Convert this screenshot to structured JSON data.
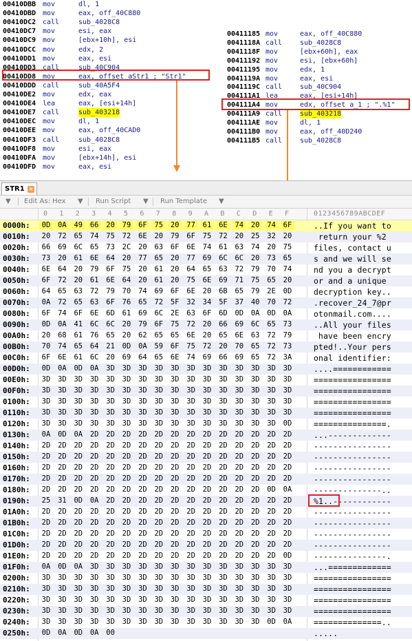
{
  "left_disasm": [
    {
      "addr": "00410DBB",
      "mn": "mov",
      "op": "dl, 1"
    },
    {
      "addr": "00410DBD",
      "mn": "mov",
      "op": "eax, off_40C880"
    },
    {
      "addr": "00410DC2",
      "mn": "call",
      "op": "sub_4028C8"
    },
    {
      "addr": "00410DC7",
      "mn": "mov",
      "op": "esi, eax"
    },
    {
      "addr": "00410DC9",
      "mn": "mov",
      "op": "[ebx+10h], esi"
    },
    {
      "addr": "00410DCC",
      "mn": "mov",
      "op": "edx, 2"
    },
    {
      "addr": "00410DD1",
      "mn": "mov",
      "op": "eax, esi"
    },
    {
      "addr": "00410DD3",
      "mn": "call",
      "op": "sub_40C904"
    },
    {
      "addr": "00410DD8",
      "mn": "mov",
      "op": "eax, offset aStr1 ; \"Str1\""
    },
    {
      "addr": "00410DDD",
      "mn": "call",
      "op": "sub_40A5F4"
    },
    {
      "addr": "00410DE2",
      "mn": "mov",
      "op": "edx, eax"
    },
    {
      "addr": "00410DE4",
      "mn": "lea",
      "op": "eax, [esi+14h]"
    },
    {
      "addr": "00410DE7",
      "mn": "call",
      "op": "sub_403218"
    },
    {
      "addr": "00410DEC",
      "mn": "mov",
      "op": "dl, 1"
    },
    {
      "addr": "00410DEE",
      "mn": "mov",
      "op": "eax, off_40CAD0"
    },
    {
      "addr": "00410DF3",
      "mn": "call",
      "op": "sub_4028C8"
    },
    {
      "addr": "00410DF8",
      "mn": "mov",
      "op": "esi, eax"
    },
    {
      "addr": "00410DFA",
      "mn": "mov",
      "op": "[ebx+14h], esi"
    },
    {
      "addr": "00410DFD",
      "mn": "mov",
      "op": "eax, esi"
    }
  ],
  "right_disasm": [
    {
      "addr": "00411185",
      "mn": "mov",
      "op": "eax, off_40C880"
    },
    {
      "addr": "0041118A",
      "mn": "call",
      "op": "sub_4028C8"
    },
    {
      "addr": "0041118F",
      "mn": "mov",
      "op": "[ebx+60h], eax"
    },
    {
      "addr": "00411192",
      "mn": "mov",
      "op": "esi, [ebx+60h]"
    },
    {
      "addr": "00411195",
      "mn": "mov",
      "op": "edx, 1"
    },
    {
      "addr": "0041119A",
      "mn": "mov",
      "op": "eax, esi"
    },
    {
      "addr": "0041119C",
      "mn": "call",
      "op": "sub_40C904"
    },
    {
      "addr": "004111A1",
      "mn": "lea",
      "op": "eax, [esi+14h]"
    },
    {
      "addr": "004111A4",
      "mn": "mov",
      "op": "edx, offset a_1 ; \".%1\""
    },
    {
      "addr": "004111A9",
      "mn": "call",
      "op": "sub_403218"
    },
    {
      "addr": "004111AE",
      "mn": "mov",
      "op": "dl, 1"
    },
    {
      "addr": "004111B0",
      "mn": "mov",
      "op": "eax, off_40D240"
    },
    {
      "addr": "004111B5",
      "mn": "call",
      "op": "sub_4028C8"
    }
  ],
  "editor": {
    "tab_label": "STR1",
    "tab_close": "×",
    "toolbar": {
      "menu_icon": "▼",
      "edit_as": "Edit As: Hex",
      "run_script": "Run Script",
      "run_template": "Run Template",
      "dropdown": "▼"
    },
    "column_headers": [
      "0",
      "1",
      "2",
      "3",
      "4",
      "5",
      "6",
      "7",
      "8",
      "9",
      "A",
      "B",
      "C",
      "D",
      "E",
      "F"
    ],
    "ascii_header": "0123456789ABCDEF",
    "rows": [
      {
        "offset": "0000h:",
        "bytes": [
          "0D",
          "0A",
          "49",
          "66",
          "20",
          "79",
          "6F",
          "75",
          "20",
          "77",
          "61",
          "6E",
          "74",
          "20",
          "74",
          "6F"
        ],
        "text": "..If you want to"
      },
      {
        "offset": "0010h:",
        "bytes": [
          "20",
          "72",
          "65",
          "74",
          "75",
          "72",
          "6E",
          "20",
          "79",
          "6F",
          "75",
          "72",
          "20",
          "25",
          "32",
          "20"
        ],
        "text": " return your %2 "
      },
      {
        "offset": "0020h:",
        "bytes": [
          "66",
          "69",
          "6C",
          "65",
          "73",
          "2C",
          "20",
          "63",
          "6F",
          "6E",
          "74",
          "61",
          "63",
          "74",
          "20",
          "75"
        ],
        "text": "files, contact u"
      },
      {
        "offset": "0030h:",
        "bytes": [
          "73",
          "20",
          "61",
          "6E",
          "64",
          "20",
          "77",
          "65",
          "20",
          "77",
          "69",
          "6C",
          "6C",
          "20",
          "73",
          "65"
        ],
        "text": "s and we will se"
      },
      {
        "offset": "0040h:",
        "bytes": [
          "6E",
          "64",
          "20",
          "79",
          "6F",
          "75",
          "20",
          "61",
          "20",
          "64",
          "65",
          "63",
          "72",
          "79",
          "70",
          "74"
        ],
        "text": "nd you a decrypt"
      },
      {
        "offset": "0050h:",
        "bytes": [
          "6F",
          "72",
          "20",
          "61",
          "6E",
          "64",
          "20",
          "61",
          "20",
          "75",
          "6E",
          "69",
          "71",
          "75",
          "65",
          "20"
        ],
        "text": "or and a unique "
      },
      {
        "offset": "0060h:",
        "bytes": [
          "64",
          "65",
          "63",
          "72",
          "79",
          "70",
          "74",
          "69",
          "6F",
          "6E",
          "20",
          "6B",
          "65",
          "79",
          "2E",
          "0D"
        ],
        "text": "decryption key.."
      },
      {
        "offset": "0070h:",
        "bytes": [
          "0A",
          "72",
          "65",
          "63",
          "6F",
          "76",
          "65",
          "72",
          "5F",
          "32",
          "34",
          "5F",
          "37",
          "40",
          "70",
          "72"
        ],
        "text": ".recover_24_7@pr"
      },
      {
        "offset": "0080h:",
        "bytes": [
          "6F",
          "74",
          "6F",
          "6E",
          "6D",
          "61",
          "69",
          "6C",
          "2E",
          "63",
          "6F",
          "6D",
          "0D",
          "0A",
          "0D",
          "0A"
        ],
        "text": "otonmail.com...."
      },
      {
        "offset": "0090h:",
        "bytes": [
          "0D",
          "0A",
          "41",
          "6C",
          "6C",
          "20",
          "79",
          "6F",
          "75",
          "72",
          "20",
          "66",
          "69",
          "6C",
          "65",
          "73"
        ],
        "text": "..All your files"
      },
      {
        "offset": "00A0h:",
        "bytes": [
          "20",
          "68",
          "61",
          "76",
          "65",
          "20",
          "62",
          "65",
          "65",
          "6E",
          "20",
          "65",
          "6E",
          "63",
          "72",
          "79"
        ],
        "text": " have been encry"
      },
      {
        "offset": "00B0h:",
        "bytes": [
          "70",
          "74",
          "65",
          "64",
          "21",
          "0D",
          "0A",
          "59",
          "6F",
          "75",
          "72",
          "20",
          "70",
          "65",
          "72",
          "73"
        ],
        "text": "pted!..Your pers"
      },
      {
        "offset": "00C0h:",
        "bytes": [
          "6F",
          "6E",
          "61",
          "6C",
          "20",
          "69",
          "64",
          "65",
          "6E",
          "74",
          "69",
          "66",
          "69",
          "65",
          "72",
          "3A"
        ],
        "text": "onal identifier:"
      },
      {
        "offset": "00D0h:",
        "bytes": [
          "0D",
          "0A",
          "0D",
          "0A",
          "3D",
          "3D",
          "3D",
          "3D",
          "3D",
          "3D",
          "3D",
          "3D",
          "3D",
          "3D",
          "3D",
          "3D"
        ],
        "text": "....============"
      },
      {
        "offset": "00E0h:",
        "bytes": [
          "3D",
          "3D",
          "3D",
          "3D",
          "3D",
          "3D",
          "3D",
          "3D",
          "3D",
          "3D",
          "3D",
          "3D",
          "3D",
          "3D",
          "3D",
          "3D"
        ],
        "text": "================"
      },
      {
        "offset": "00F0h:",
        "bytes": [
          "3D",
          "3D",
          "3D",
          "3D",
          "3D",
          "3D",
          "3D",
          "3D",
          "3D",
          "3D",
          "3D",
          "3D",
          "3D",
          "3D",
          "3D",
          "3D"
        ],
        "text": "================"
      },
      {
        "offset": "0100h:",
        "bytes": [
          "3D",
          "3D",
          "3D",
          "3D",
          "3D",
          "3D",
          "3D",
          "3D",
          "3D",
          "3D",
          "3D",
          "3D",
          "3D",
          "3D",
          "3D",
          "3D"
        ],
        "text": "================"
      },
      {
        "offset": "0110h:",
        "bytes": [
          "3D",
          "3D",
          "3D",
          "3D",
          "3D",
          "3D",
          "3D",
          "3D",
          "3D",
          "3D",
          "3D",
          "3D",
          "3D",
          "3D",
          "3D",
          "3D"
        ],
        "text": "================"
      },
      {
        "offset": "0120h:",
        "bytes": [
          "3D",
          "3D",
          "3D",
          "3D",
          "3D",
          "3D",
          "3D",
          "3D",
          "3D",
          "3D",
          "3D",
          "3D",
          "3D",
          "3D",
          "3D",
          "0D"
        ],
        "text": "===============."
      },
      {
        "offset": "0130h:",
        "bytes": [
          "0A",
          "0D",
          "0A",
          "2D",
          "2D",
          "2D",
          "2D",
          "2D",
          "2D",
          "2D",
          "2D",
          "2D",
          "2D",
          "2D",
          "2D",
          "2D"
        ],
        "text": "...-------------"
      },
      {
        "offset": "0140h:",
        "bytes": [
          "2D",
          "2D",
          "2D",
          "2D",
          "2D",
          "2D",
          "2D",
          "2D",
          "2D",
          "2D",
          "2D",
          "2D",
          "2D",
          "2D",
          "2D",
          "2D"
        ],
        "text": "----------------"
      },
      {
        "offset": "0150h:",
        "bytes": [
          "2D",
          "2D",
          "2D",
          "2D",
          "2D",
          "2D",
          "2D",
          "2D",
          "2D",
          "2D",
          "2D",
          "2D",
          "2D",
          "2D",
          "2D",
          "2D"
        ],
        "text": "----------------"
      },
      {
        "offset": "0160h:",
        "bytes": [
          "2D",
          "2D",
          "2D",
          "2D",
          "2D",
          "2D",
          "2D",
          "2D",
          "2D",
          "2D",
          "2D",
          "2D",
          "2D",
          "2D",
          "2D",
          "2D"
        ],
        "text": "----------------"
      },
      {
        "offset": "0170h:",
        "bytes": [
          "2D",
          "2D",
          "2D",
          "2D",
          "2D",
          "2D",
          "2D",
          "2D",
          "2D",
          "2D",
          "2D",
          "2D",
          "2D",
          "2D",
          "2D",
          "2D"
        ],
        "text": "----------------"
      },
      {
        "offset": "0180h:",
        "bytes": [
          "2D",
          "2D",
          "2D",
          "2D",
          "2D",
          "2D",
          "2D",
          "2D",
          "2D",
          "2D",
          "2D",
          "2D",
          "2D",
          "2D",
          "0D",
          "0A"
        ],
        "text": "--------------.."
      },
      {
        "offset": "0190h:",
        "bytes": [
          "25",
          "31",
          "0D",
          "0A",
          "2D",
          "2D",
          "2D",
          "2D",
          "2D",
          "2D",
          "2D",
          "2D",
          "2D",
          "2D",
          "2D",
          "2D"
        ],
        "text": "%1..------------"
      },
      {
        "offset": "01A0h:",
        "bytes": [
          "2D",
          "2D",
          "2D",
          "2D",
          "2D",
          "2D",
          "2D",
          "2D",
          "2D",
          "2D",
          "2D",
          "2D",
          "2D",
          "2D",
          "2D",
          "2D"
        ],
        "text": "----------------"
      },
      {
        "offset": "01B0h:",
        "bytes": [
          "2D",
          "2D",
          "2D",
          "2D",
          "2D",
          "2D",
          "2D",
          "2D",
          "2D",
          "2D",
          "2D",
          "2D",
          "2D",
          "2D",
          "2D",
          "2D"
        ],
        "text": "----------------"
      },
      {
        "offset": "01C0h:",
        "bytes": [
          "2D",
          "2D",
          "2D",
          "2D",
          "2D",
          "2D",
          "2D",
          "2D",
          "2D",
          "2D",
          "2D",
          "2D",
          "2D",
          "2D",
          "2D",
          "2D"
        ],
        "text": "----------------"
      },
      {
        "offset": "01D0h:",
        "bytes": [
          "2D",
          "2D",
          "2D",
          "2D",
          "2D",
          "2D",
          "2D",
          "2D",
          "2D",
          "2D",
          "2D",
          "2D",
          "2D",
          "2D",
          "2D",
          "2D"
        ],
        "text": "----------------"
      },
      {
        "offset": "01E0h:",
        "bytes": [
          "2D",
          "2D",
          "2D",
          "2D",
          "2D",
          "2D",
          "2D",
          "2D",
          "2D",
          "2D",
          "2D",
          "2D",
          "2D",
          "2D",
          "2D",
          "0D"
        ],
        "text": "---------------."
      },
      {
        "offset": "01F0h:",
        "bytes": [
          "0A",
          "0D",
          "0A",
          "3D",
          "3D",
          "3D",
          "3D",
          "3D",
          "3D",
          "3D",
          "3D",
          "3D",
          "3D",
          "3D",
          "3D",
          "3D"
        ],
        "text": "...============="
      },
      {
        "offset": "0200h:",
        "bytes": [
          "3D",
          "3D",
          "3D",
          "3D",
          "3D",
          "3D",
          "3D",
          "3D",
          "3D",
          "3D",
          "3D",
          "3D",
          "3D",
          "3D",
          "3D",
          "3D"
        ],
        "text": "================"
      },
      {
        "offset": "0210h:",
        "bytes": [
          "3D",
          "3D",
          "3D",
          "3D",
          "3D",
          "3D",
          "3D",
          "3D",
          "3D",
          "3D",
          "3D",
          "3D",
          "3D",
          "3D",
          "3D",
          "3D"
        ],
        "text": "================"
      },
      {
        "offset": "0220h:",
        "bytes": [
          "3D",
          "3D",
          "3D",
          "3D",
          "3D",
          "3D",
          "3D",
          "3D",
          "3D",
          "3D",
          "3D",
          "3D",
          "3D",
          "3D",
          "3D",
          "3D"
        ],
        "text": "================"
      },
      {
        "offset": "0230h:",
        "bytes": [
          "3D",
          "3D",
          "3D",
          "3D",
          "3D",
          "3D",
          "3D",
          "3D",
          "3D",
          "3D",
          "3D",
          "3D",
          "3D",
          "3D",
          "3D",
          "3D"
        ],
        "text": "================"
      },
      {
        "offset": "0240h:",
        "bytes": [
          "3D",
          "3D",
          "3D",
          "3D",
          "3D",
          "3D",
          "3D",
          "3D",
          "3D",
          "3D",
          "3D",
          "3D",
          "3D",
          "3D",
          "0D",
          "0A"
        ],
        "text": "==============.."
      },
      {
        "offset": "0250h:",
        "bytes": [
          "0D",
          "0A",
          "0D",
          "0A",
          "00"
        ],
        "text": "....."
      }
    ]
  },
  "colors": {
    "highlight_box": "#e02020",
    "arrow": "#f08a24",
    "first_row_highlight": "#ffffa8",
    "alt_row": "#eeeef8"
  }
}
